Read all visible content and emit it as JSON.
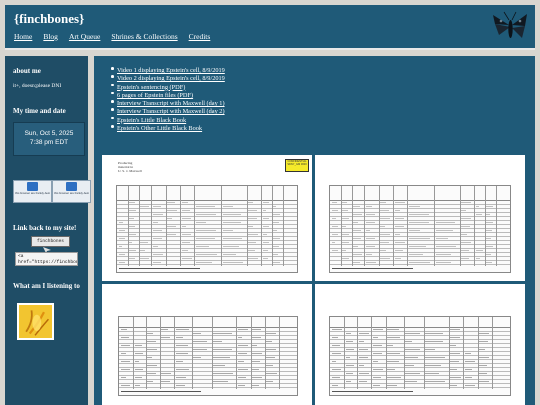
{
  "header": {
    "title": "{finchbones}",
    "nav": [
      "Home",
      "Blog",
      "Art Queue",
      "Shrines & Collections",
      "Credits"
    ],
    "logo_icon": "moth-logo-icon"
  },
  "sidebar": {
    "about_heading": "about me",
    "about_text": "it+, doesn;please DNI",
    "time_heading": "My time and date",
    "clock": {
      "date": "Sun, Oct 5, 2025",
      "time": "7:38 pm EDT"
    },
    "badges": [
      {
        "text": "this browser are frankly-being viewed-percent-age-supported"
      },
      {
        "text": "this browser are frankly-being viewed-percent-age-supported"
      }
    ],
    "link_heading": "Link back to my site!",
    "button_label": "finchbones",
    "code_snippet": "<a\nhref=\"https://finchbon.",
    "listening_heading": "What am I listening to"
  },
  "main": {
    "links": [
      "Video 1 displaying Epstein's cell, 8/9/2019",
      "Video 2 displaying Epstein's cell, 8/9/2019",
      "Epstein's sentencing (PDF)",
      "6 pages of Epstein files (PDF)",
      "Interview Transcript with Maxwell (day 1)",
      "Interview Transcript with Maxwell (day 2)",
      "Epstein's Little Black Book",
      "Epstein's Other Little Black Book"
    ],
    "documents": [
      {
        "note": "Producing\nmaterial in\nU. S. v. Maxwell",
        "stamp": "CONFIDENTIAL\nSDNY_GM\n0000"
      },
      {
        "note": "",
        "stamp": ""
      },
      {
        "note": "",
        "stamp": ""
      },
      {
        "note": "",
        "stamp": ""
      }
    ]
  },
  "colors": {
    "header_bg": "#1f5a78",
    "sidebar_bg": "#1f4d66",
    "main_bg": "#1f5a78",
    "page_bg": "#d8d6d0",
    "stamp_yellow": "#f5ea2a"
  }
}
